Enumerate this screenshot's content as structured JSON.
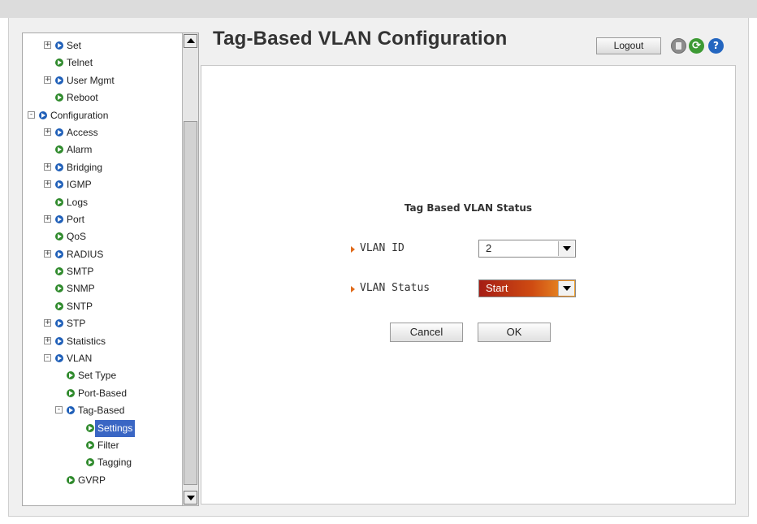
{
  "header": {
    "title": "Tag-Based VLAN Configuration",
    "logout_label": "Logout",
    "icons": [
      "save-icon",
      "refresh-icon",
      "help-icon"
    ],
    "help_glyph": "?",
    "refresh_glyph": "⟳"
  },
  "sidebar": {
    "items": [
      {
        "label": "Set",
        "level": 1,
        "expander": "+",
        "bullet": "blue"
      },
      {
        "label": "Telnet",
        "level": 2,
        "expander": "",
        "bullet": "green"
      },
      {
        "label": "User Mgmt",
        "level": 1,
        "expander": "+",
        "bullet": "blue"
      },
      {
        "label": "Reboot",
        "level": 2,
        "expander": "",
        "bullet": "green"
      },
      {
        "label": "Configuration",
        "level": 0,
        "expander": "-",
        "bullet": "blue"
      },
      {
        "label": "Access",
        "level": 1,
        "expander": "+",
        "bullet": "blue"
      },
      {
        "label": "Alarm",
        "level": 2,
        "expander": "",
        "bullet": "green"
      },
      {
        "label": "Bridging",
        "level": 1,
        "expander": "+",
        "bullet": "blue"
      },
      {
        "label": "IGMP",
        "level": 1,
        "expander": "+",
        "bullet": "blue"
      },
      {
        "label": "Logs",
        "level": 2,
        "expander": "",
        "bullet": "green"
      },
      {
        "label": "Port",
        "level": 1,
        "expander": "+",
        "bullet": "blue"
      },
      {
        "label": "QoS",
        "level": 2,
        "expander": "",
        "bullet": "green"
      },
      {
        "label": "RADIUS",
        "level": 1,
        "expander": "+",
        "bullet": "blue"
      },
      {
        "label": "SMTP",
        "level": 2,
        "expander": "",
        "bullet": "green"
      },
      {
        "label": "SNMP",
        "level": 2,
        "expander": "",
        "bullet": "green"
      },
      {
        "label": "SNTP",
        "level": 2,
        "expander": "",
        "bullet": "green"
      },
      {
        "label": "STP",
        "level": 1,
        "expander": "+",
        "bullet": "blue"
      },
      {
        "label": "Statistics",
        "level": 1,
        "expander": "+",
        "bullet": "blue"
      },
      {
        "label": "VLAN",
        "level": 1,
        "expander": "-",
        "bullet": "blue"
      },
      {
        "label": "Set Type",
        "level": 3,
        "expander": "",
        "bullet": "green"
      },
      {
        "label": "Port-Based",
        "level": 3,
        "expander": "",
        "bullet": "green"
      },
      {
        "label": "Tag-Based",
        "level": 2,
        "expander": "-",
        "bullet": "blue"
      },
      {
        "label": "Settings",
        "level": 4,
        "expander": "",
        "bullet": "green",
        "selected": true
      },
      {
        "label": "Filter",
        "level": 4,
        "expander": "",
        "bullet": "green"
      },
      {
        "label": "Tagging",
        "level": 4,
        "expander": "",
        "bullet": "green"
      },
      {
        "label": "GVRP",
        "level": 3,
        "expander": "",
        "bullet": "green"
      }
    ]
  },
  "form": {
    "section_title": "Tag Based VLAN Status",
    "vlan_id_label": "VLAN ID",
    "vlan_id_value": "2",
    "vlan_status_label": "VLAN Status",
    "vlan_status_value": "Start",
    "cancel_label": "Cancel",
    "ok_label": "OK"
  },
  "colors": {
    "selected_bg": "#3a66c4",
    "status_gradient_start": "#a51c14",
    "status_gradient_end": "#f0a02a",
    "bullet_blue": "#1f5fb8",
    "bullet_green": "#2f8a2c"
  }
}
